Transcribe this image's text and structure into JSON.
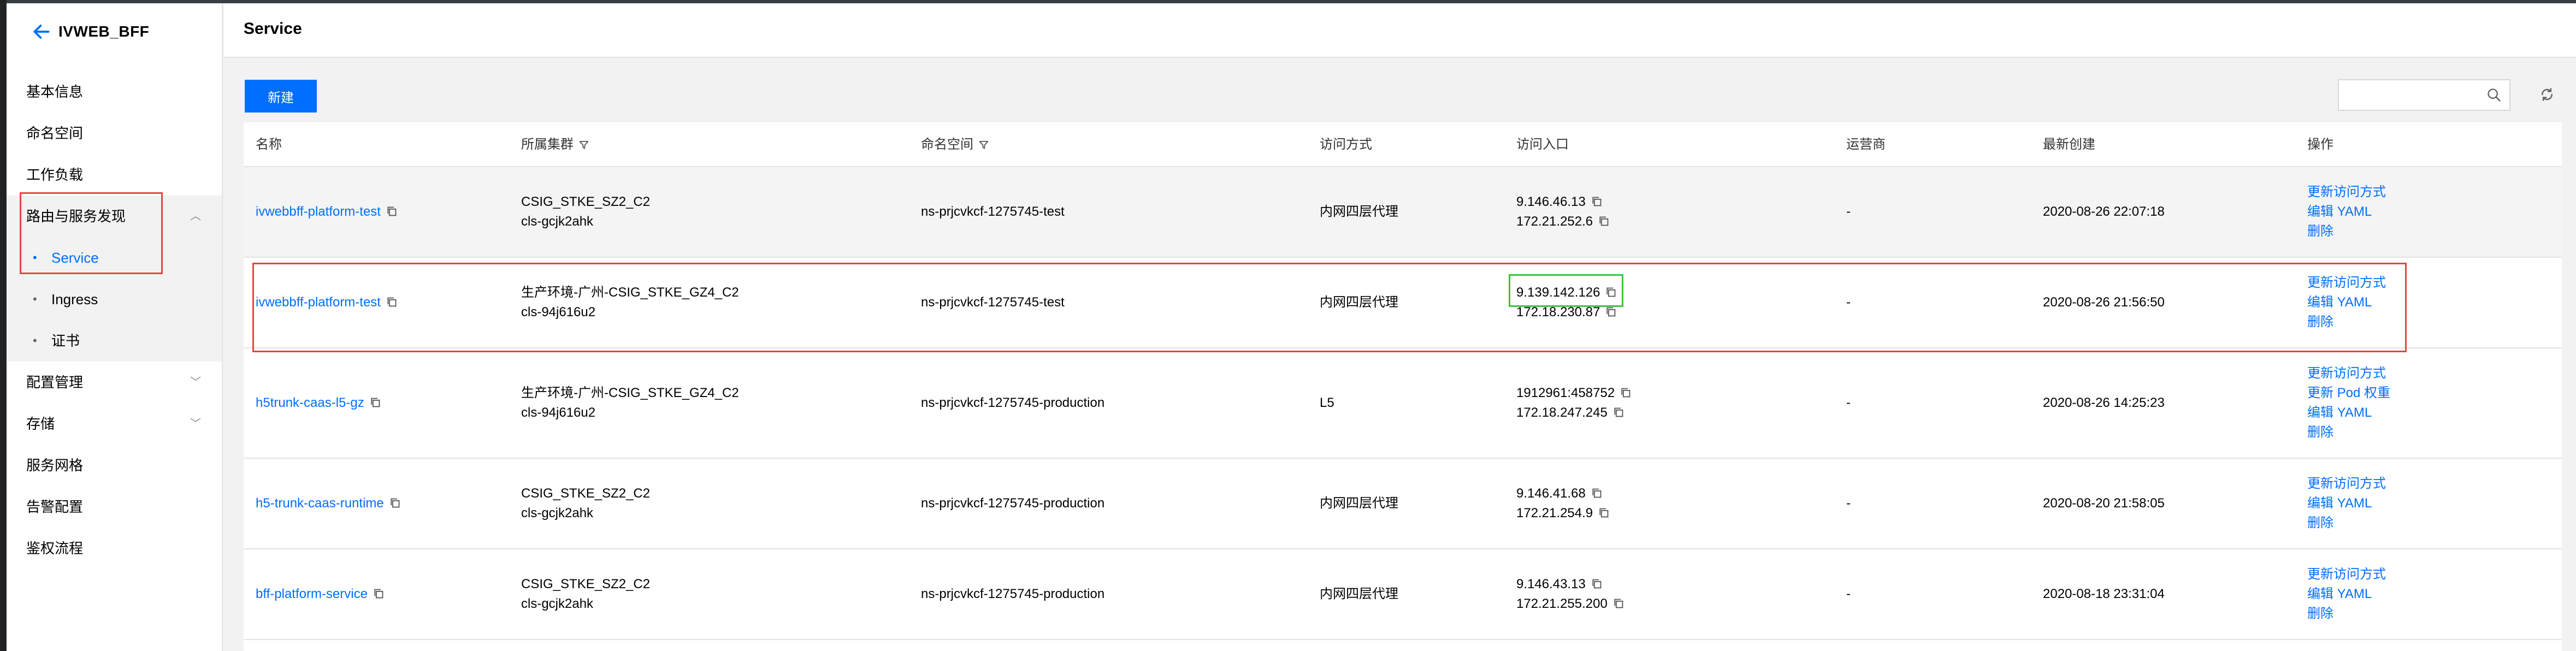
{
  "app": {
    "title": "IVWEB_BFF"
  },
  "sidebar": {
    "items": [
      {
        "label": "基本信息"
      },
      {
        "label": "命名空间"
      },
      {
        "label": "工作负载"
      },
      {
        "label": "路由与服务发现"
      },
      {
        "label": "Service"
      },
      {
        "label": "Ingress"
      },
      {
        "label": "证书"
      },
      {
        "label": "配置管理"
      },
      {
        "label": "存储"
      },
      {
        "label": "服务网格"
      },
      {
        "label": "告警配置"
      },
      {
        "label": "鉴权流程"
      }
    ],
    "active": "Service"
  },
  "page": {
    "title": "Service"
  },
  "toolbar": {
    "new_label": "新建",
    "search_placeholder": ""
  },
  "table": {
    "headers": {
      "name": "名称",
      "cluster": "所属集群",
      "namespace": "命名空间",
      "access": "访问方式",
      "entry": "访问入口",
      "provider": "运营商",
      "created": "最新创建",
      "actions": "操作"
    },
    "rows": [
      {
        "name": "ivwebbff-platform-test",
        "cluster": "CSIG_STKE_SZ2_C2",
        "cluster_id": "cls-gcjk2ahk",
        "namespace": "ns-prjcvkcf-1275745-test",
        "access": "内网四层代理",
        "entry1": "9.146.46.13",
        "entry2": "172.21.252.6",
        "provider": "-",
        "created": "2020-08-26 22:07:18",
        "actions": [
          "更新访问方式",
          "编辑 YAML",
          "删除"
        ]
      },
      {
        "name": "ivwebbff-platform-test",
        "cluster": "生产环境-广州-CSIG_STKE_GZ4_C2",
        "cluster_id": "cls-94j616u2",
        "namespace": "ns-prjcvkcf-1275745-test",
        "access": "内网四层代理",
        "entry1": "9.139.142.126",
        "entry2": "172.18.230.87",
        "provider": "-",
        "created": "2020-08-26 21:56:50",
        "actions": [
          "更新访问方式",
          "编辑 YAML",
          "删除"
        ]
      },
      {
        "name": "h5trunk-caas-l5-gz",
        "cluster": "生产环境-广州-CSIG_STKE_GZ4_C2",
        "cluster_id": "cls-94j616u2",
        "namespace": "ns-prjcvkcf-1275745-production",
        "access": "L5",
        "entry1": "1912961:458752",
        "entry2": "172.18.247.245",
        "provider": "-",
        "created": "2020-08-26 14:25:23",
        "actions": [
          "更新访问方式",
          "更新 Pod 权重",
          "编辑 YAML",
          "删除"
        ]
      },
      {
        "name": "h5-trunk-caas-runtime",
        "cluster": "CSIG_STKE_SZ2_C2",
        "cluster_id": "cls-gcjk2ahk",
        "namespace": "ns-prjcvkcf-1275745-production",
        "access": "内网四层代理",
        "entry1": "9.146.41.68",
        "entry2": "172.21.254.9",
        "provider": "-",
        "created": "2020-08-20 21:58:05",
        "actions": [
          "更新访问方式",
          "编辑 YAML",
          "删除"
        ]
      },
      {
        "name": "bff-platform-service",
        "cluster": "CSIG_STKE_SZ2_C2",
        "cluster_id": "cls-gcjk2ahk",
        "namespace": "ns-prjcvkcf-1275745-production",
        "access": "内网四层代理",
        "entry1": "9.146.43.13",
        "entry2": "172.21.255.200",
        "provider": "-",
        "created": "2020-08-18 23:31:04",
        "actions": [
          "更新访问方式",
          "编辑 YAML",
          "删除"
        ]
      }
    ]
  },
  "colors": {
    "accent": "#006eff",
    "highlight_red": "#e54545",
    "highlight_green": "#3cc43c",
    "sidebar_dark": "#1f2326"
  }
}
